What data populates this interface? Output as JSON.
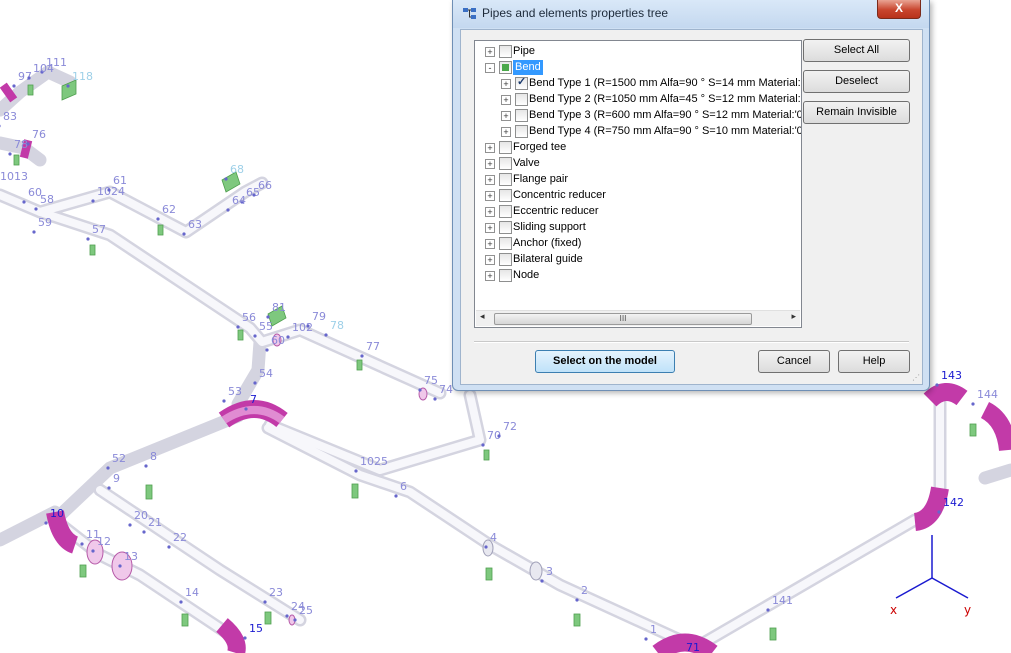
{
  "dialog": {
    "title": "Pipes and elements properties tree",
    "close_label": "X",
    "buttons": {
      "select_all": "Select All",
      "deselect": "Deselect",
      "remain_invisible": "Remain Invisible",
      "select_on_model": "Select on the model",
      "cancel": "Cancel",
      "help": "Help"
    },
    "tree": [
      {
        "label": "Pipe",
        "level": 0,
        "expander": "+",
        "check": "none"
      },
      {
        "label": "Bend",
        "level": 0,
        "expander": "-",
        "check": "partial",
        "selected": true
      },
      {
        "label": "Bend Type 1 (R=1500 mm Alfa=90 ° S=14 mm Material:'",
        "level": 1,
        "expander": "+",
        "check": "checked"
      },
      {
        "label": "Bend Type 2 (R=1050 mm Alfa=45 ° S=12 mm Material:'",
        "level": 1,
        "expander": "+",
        "check": "none"
      },
      {
        "label": "Bend Type 3 (R=600 mm Alfa=90 ° S=12 mm Material:'0",
        "level": 1,
        "expander": "+",
        "check": "none"
      },
      {
        "label": "Bend Type 4 (R=750 mm Alfa=90 ° S=10 mm Material:'0",
        "level": 1,
        "expander": "+",
        "check": "none"
      },
      {
        "label": "Forged tee",
        "level": 0,
        "expander": "+",
        "check": "none"
      },
      {
        "label": "Valve",
        "level": 0,
        "expander": "+",
        "check": "none"
      },
      {
        "label": "Flange pair",
        "level": 0,
        "expander": "+",
        "check": "none"
      },
      {
        "label": "Concentric reducer",
        "level": 0,
        "expander": "+",
        "check": "none"
      },
      {
        "label": "Eccentric reducer",
        "level": 0,
        "expander": "+",
        "check": "none"
      },
      {
        "label": "Sliding support",
        "level": 0,
        "expander": "+",
        "check": "none"
      },
      {
        "label": "Anchor (fixed)",
        "level": 0,
        "expander": "+",
        "check": "none"
      },
      {
        "label": "Bilateral guide",
        "level": 0,
        "expander": "+",
        "check": "none"
      },
      {
        "label": "Node",
        "level": 0,
        "expander": "+",
        "check": "none"
      }
    ],
    "scroll_thumb_grip": "III"
  },
  "axes": {
    "x": "x",
    "y": "y"
  },
  "node_labels": [
    [
      "111",
      46,
      66
    ],
    [
      "97",
      18,
      80
    ],
    [
      "104",
      33,
      72
    ],
    [
      "118",
      72,
      80
    ],
    [
      "83",
      3,
      120
    ],
    [
      "76",
      32,
      138
    ],
    [
      "78",
      14,
      148
    ],
    [
      "1013",
      0,
      180
    ],
    [
      "60",
      28,
      196
    ],
    [
      "58",
      40,
      203
    ],
    [
      "59",
      38,
      226
    ],
    [
      "1024",
      97,
      195
    ],
    [
      "61",
      113,
      184
    ],
    [
      "62",
      162,
      213
    ],
    [
      "63",
      188,
      228
    ],
    [
      "57",
      92,
      233
    ],
    [
      "68",
      230,
      173
    ],
    [
      "65",
      246,
      196
    ],
    [
      "66",
      258,
      189
    ],
    [
      "64",
      232,
      204
    ],
    [
      "56",
      242,
      321
    ],
    [
      "81",
      272,
      311
    ],
    [
      "55",
      259,
      330
    ],
    [
      "79",
      312,
      320
    ],
    [
      "102",
      292,
      331
    ],
    [
      "78",
      330,
      329
    ],
    [
      "60",
      271,
      344
    ],
    [
      "77",
      366,
      350
    ],
    [
      "54",
      259,
      377
    ],
    [
      "53",
      228,
      395
    ],
    [
      "75",
      424,
      384
    ],
    [
      "74",
      439,
      393
    ],
    [
      "7",
      250,
      403
    ],
    [
      "1025",
      360,
      465
    ],
    [
      "70",
      487,
      439
    ],
    [
      "72",
      503,
      430
    ],
    [
      "52",
      112,
      462
    ],
    [
      "8",
      150,
      460
    ],
    [
      "9",
      113,
      482
    ],
    [
      "6",
      400,
      490
    ],
    [
      "20",
      134,
      519
    ],
    [
      "21",
      148,
      526
    ],
    [
      "22",
      173,
      541
    ],
    [
      "10",
      50,
      517
    ],
    [
      "11",
      86,
      538
    ],
    [
      "12",
      97,
      545
    ],
    [
      "13",
      124,
      560
    ],
    [
      "4",
      490,
      541
    ],
    [
      "3",
      546,
      575
    ],
    [
      "2",
      581,
      594
    ],
    [
      "14",
      185,
      596
    ],
    [
      "23",
      269,
      596
    ],
    [
      "24",
      291,
      610
    ],
    [
      "25",
      299,
      614
    ],
    [
      "15",
      249,
      632
    ],
    [
      "1",
      650,
      633
    ],
    [
      "71",
      686,
      651
    ],
    [
      "141",
      772,
      604
    ],
    [
      "143",
      941,
      379
    ],
    [
      "144",
      977,
      398
    ],
    [
      "142",
      943,
      506
    ]
  ]
}
